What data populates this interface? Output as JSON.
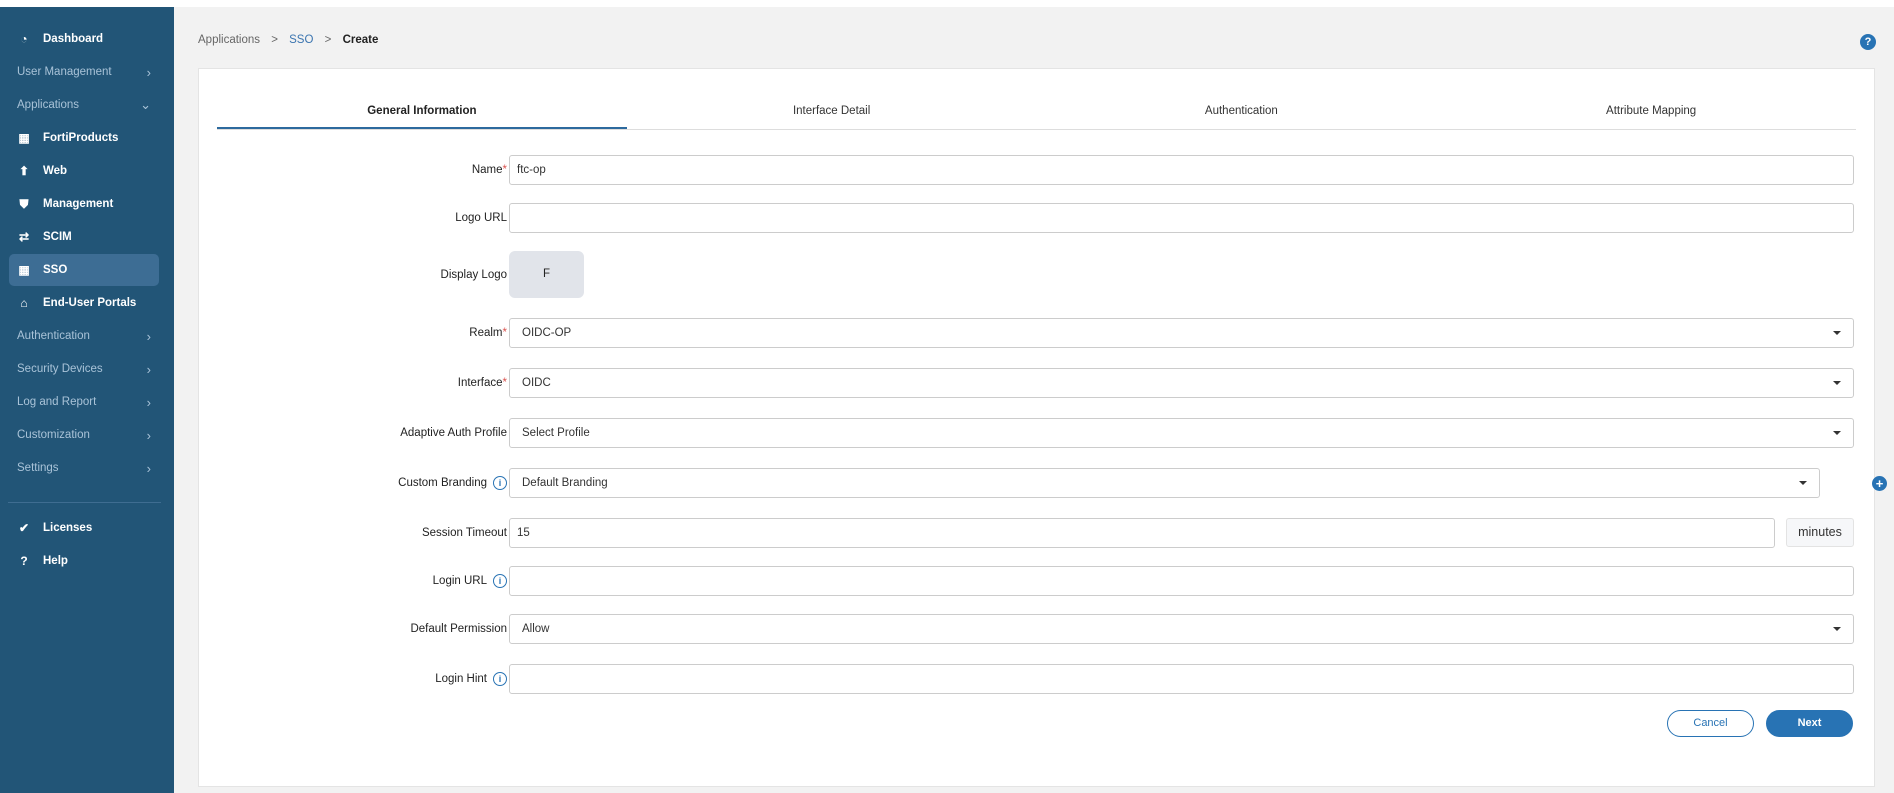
{
  "sidebar": {
    "items": [
      {
        "label": "Dashboard",
        "type": "item",
        "icon": "dashboard-icon"
      },
      {
        "label": "User Management",
        "type": "group"
      },
      {
        "label": "Applications",
        "type": "group",
        "expanded": true
      },
      {
        "label": "FortiProducts",
        "type": "item",
        "icon": "fortiproducts-icon"
      },
      {
        "label": "Web",
        "type": "item",
        "icon": "web-icon"
      },
      {
        "label": "Management",
        "type": "item",
        "icon": "shield-icon"
      },
      {
        "label": "SCIM",
        "type": "item",
        "icon": "scim-icon"
      },
      {
        "label": "SSO",
        "type": "item",
        "icon": "grid-icon",
        "active": true
      },
      {
        "label": "End-User Portals",
        "type": "item",
        "icon": "home-icon"
      },
      {
        "label": "Authentication",
        "type": "group"
      },
      {
        "label": "Security Devices",
        "type": "group"
      },
      {
        "label": "Log and Report",
        "type": "group"
      },
      {
        "label": "Customization",
        "type": "group"
      },
      {
        "label": "Settings",
        "type": "group"
      },
      {
        "label": "Licenses",
        "type": "item",
        "icon": "badge-check-icon"
      },
      {
        "label": "Help",
        "type": "item",
        "icon": "help-icon"
      }
    ]
  },
  "breadcrumb": {
    "items": [
      "Applications",
      "SSO",
      "Create"
    ],
    "separator": ">"
  },
  "help_icon": "?",
  "tabs": [
    "General Information",
    "Interface Detail",
    "Authentication",
    "Attribute Mapping"
  ],
  "form": {
    "name": {
      "label": "Name",
      "value": "ftc-op"
    },
    "logo_url": {
      "label": "Logo URL",
      "value": ""
    },
    "display_logo": {
      "label": "Display Logo",
      "value": "F"
    },
    "realm": {
      "label": "Realm",
      "value": "OIDC-OP"
    },
    "interface": {
      "label": "Interface",
      "value": "OIDC"
    },
    "adaptive_auth": {
      "label": "Adaptive Auth Profile",
      "value": "Select Profile"
    },
    "custom_branding": {
      "label": "Custom Branding",
      "value": "Default Branding"
    },
    "session_timeout": {
      "label": "Session Timeout",
      "value": "15",
      "unit": "minutes"
    },
    "login_url": {
      "label": "Login URL",
      "value": ""
    },
    "default_permission": {
      "label": "Default Permission",
      "value": "Allow"
    },
    "login_hint": {
      "label": "Login Hint",
      "value": ""
    },
    "required_mark": "*",
    "info_mark": "i",
    "plus_mark": "+"
  },
  "buttons": {
    "cancel": "Cancel",
    "next": "Next"
  },
  "colors": {
    "sidebar": "#225577",
    "accent": "#2873b4",
    "active": "#3d6d94"
  }
}
